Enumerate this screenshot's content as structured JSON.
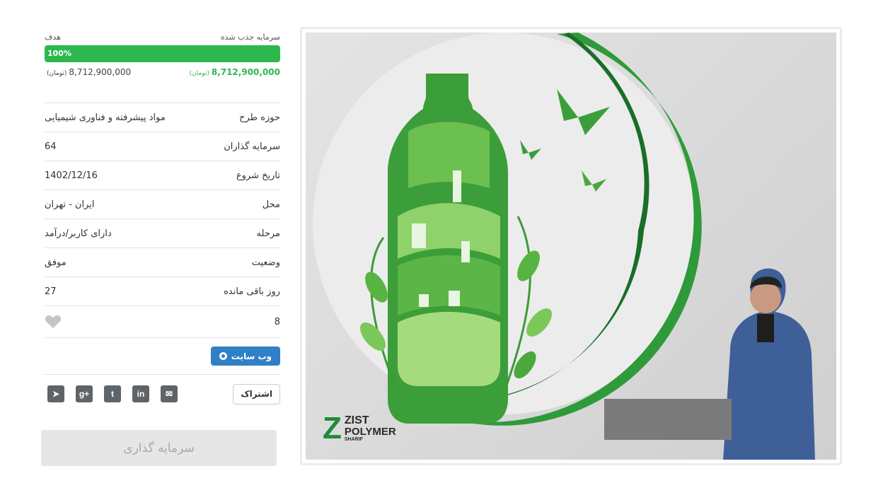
{
  "funding": {
    "raised_label": "سرمایه جذب شده",
    "goal_label": "هدف",
    "progress_text": "100%",
    "progress_percent": 100,
    "raised_amount": "8,712,900,000",
    "goal_amount": "8,712,900,000",
    "currency": "(تومان)"
  },
  "details": [
    {
      "label": "حوزه طرح",
      "value": "مواد پیشرفته و فناوری شیمیایی"
    },
    {
      "label": "سرمایه گذاران",
      "value": "64"
    },
    {
      "label": "تاریخ شروع",
      "value": "1402/12/16"
    },
    {
      "label": "محل",
      "value": "ایران - تهران"
    },
    {
      "label": "مرحله",
      "value": "دارای کاربر/درآمد"
    },
    {
      "label": "وضعیت",
      "value": "موفق"
    },
    {
      "label": "روز باقی مانده",
      "value": "27"
    }
  ],
  "likes": "8",
  "website_button": "وب سایت",
  "share_button": "اشتراک",
  "social_icons": [
    "email-icon",
    "linkedin-icon",
    "twitter-icon",
    "google-plus-icon",
    "telegram-icon"
  ],
  "social_glyphs": {
    "email": "✉",
    "linkedin": "in",
    "twitter": "t",
    "googleplus": "g+",
    "telegram": "➤"
  },
  "invest_button": "سرمایه گذاری",
  "image": {
    "brand_line1": "ZIST",
    "brand_line2": "POLYMER",
    "brand_line3": "SHARIF",
    "brand_letter": "Z"
  },
  "colors": {
    "accent_green": "#2db84d",
    "button_blue": "#2f80c6",
    "icon_gray": "#5e6468"
  }
}
